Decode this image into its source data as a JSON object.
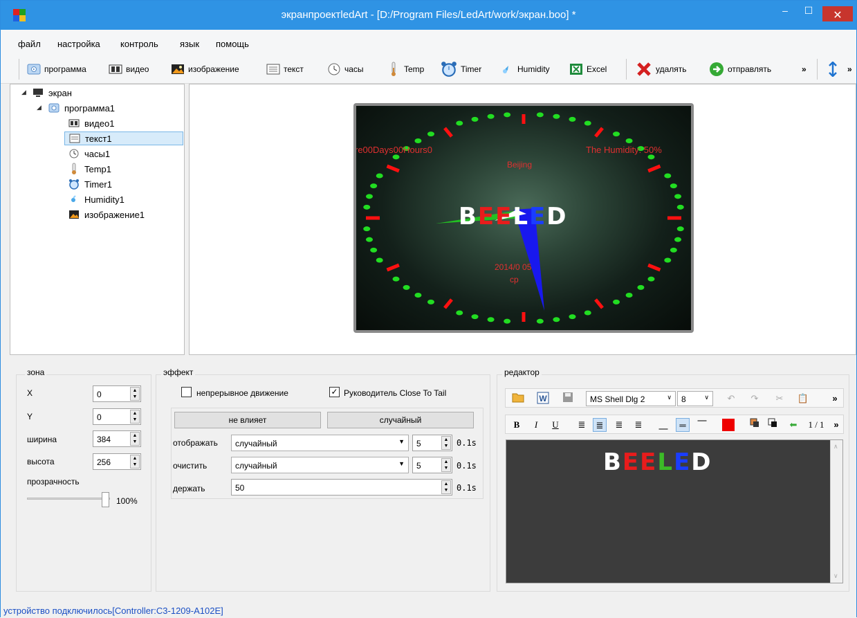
{
  "window": {
    "title": "экранпроектledArt - [D:/Program Files/LedArt/work/экран.boo] *",
    "min": "–",
    "max": "☐",
    "close": "✕"
  },
  "menu": [
    "файл",
    "настройка",
    "контроль",
    "язык",
    "помощь"
  ],
  "toolbar": {
    "program": "программа",
    "video": "видео",
    "image": "изображение",
    "text": "текст",
    "clock": "часы",
    "temp": "Temp",
    "timer": "Timer",
    "humidity": "Humidity",
    "excel": "Excel",
    "delete": "удалять",
    "send": "отправлять",
    "more": "»"
  },
  "tree": {
    "root": "экран",
    "program": "программа1",
    "items": [
      "видео1",
      "текст1",
      "часы1",
      "Temp1",
      "Timer1",
      "Humidity1",
      "изображение1"
    ]
  },
  "preview": {
    "countdown": "re00Days00Hours0",
    "humidity_text": "The Humidity: 50%",
    "city": "Beijing",
    "date": "2014/0 05",
    "weekday": "ср",
    "logo": [
      "B",
      "E",
      "E",
      "L",
      "E",
      "D"
    ],
    "logo_colors": [
      "#ffffff",
      "#e81c1c",
      "#e81c1c",
      "#ffffff",
      "#1a3dff",
      "#ffffff"
    ]
  },
  "zone": {
    "title": "зона",
    "x_label": "X",
    "x": "0",
    "y_label": "Y",
    "y": "0",
    "w_label": "ширина",
    "w": "384",
    "h_label": "высота",
    "h": "256",
    "transparency_label": "прозрачность",
    "transparency": "100%",
    "transparency_value": 1.0
  },
  "effect": {
    "title": "эффект",
    "continuous": "непрерывное движение",
    "continuous_checked": false,
    "close_to_tail": "Руководитель Close To Tail",
    "close_to_tail_checked": true,
    "btn_no_effect": "не влияет",
    "btn_random": "случайный",
    "show_label": "отображать",
    "show_value": "случайный",
    "show_speed": "5",
    "show_unit": "0.1s",
    "clear_label": "очистить",
    "clear_value": "случайный",
    "clear_speed": "5",
    "clear_unit": "0.1s",
    "hold_label": "держать",
    "hold_value": "50",
    "hold_unit": "0.1s"
  },
  "editor": {
    "title": "редактор",
    "font": "MS Shell Dlg 2",
    "size": "8",
    "bold": "B",
    "italic": "I",
    "underline": "U",
    "page": "1 / 1",
    "more": "»",
    "content": [
      "B",
      "E",
      "E",
      "L",
      "E",
      "D"
    ]
  },
  "status": "устройство подключилось[Controller:C3-1209-A102E]"
}
